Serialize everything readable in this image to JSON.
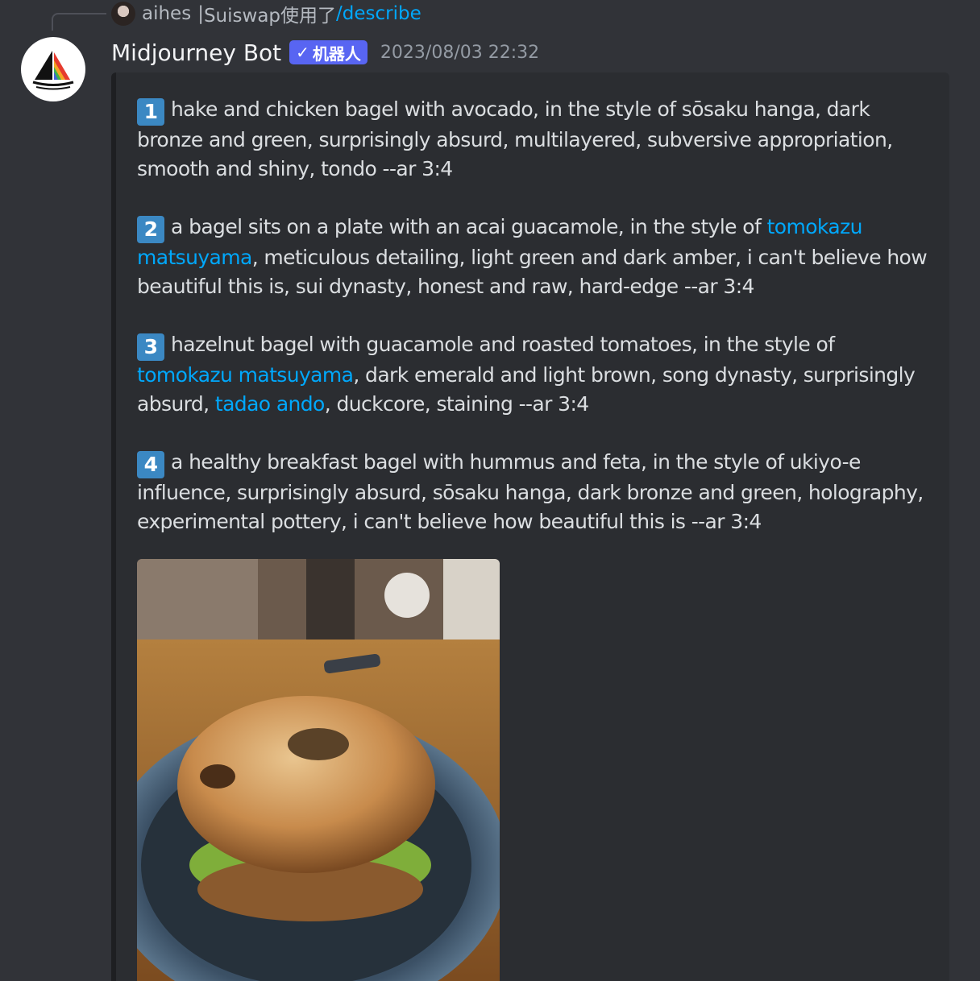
{
  "reply": {
    "username": "aihes",
    "separator": "|",
    "context": "Suiswap使用了",
    "command": "/describe"
  },
  "message": {
    "author": "Midjourney Bot",
    "badge": "机器人",
    "badge_check": "✓",
    "timestamp": "2023/08/03 22:32"
  },
  "prompts": [
    {
      "number": "1",
      "segments": [
        {
          "text": "hake and chicken bagel with avocado, in the style of sōsaku hanga, dark bronze and green, surprisingly absurd, multilayered, subversive appropriation, smooth and shiny, tondo --ar 3:4",
          "link": false
        }
      ]
    },
    {
      "number": "2",
      "segments": [
        {
          "text": "a bagel sits on a plate with an acai guacamole, in the style of ",
          "link": false
        },
        {
          "text": "tomokazu matsuyama",
          "link": true
        },
        {
          "text": ", meticulous detailing, light green and dark amber, i can't believe how beautiful this is, sui dynasty, honest and raw, hard-edge --ar 3:4",
          "link": false
        }
      ]
    },
    {
      "number": "3",
      "segments": [
        {
          "text": "hazelnut bagel with guacamole and roasted tomatoes, in the style of ",
          "link": false
        },
        {
          "text": "tomokazu matsuyama",
          "link": true
        },
        {
          "text": ", dark emerald and light brown, song dynasty, surprisingly absurd, ",
          "link": false
        },
        {
          "text": "tadao ando",
          "link": true
        },
        {
          "text": ", duckcore, staining --ar 3:4",
          "link": false
        }
      ]
    },
    {
      "number": "4",
      "segments": [
        {
          "text": "a healthy breakfast bagel with hummus and feta, in the style of ukiyo-e influence, surprisingly absurd, sōsaku hanga, dark bronze and green, holography, experimental pottery, i can't believe how beautiful this is --ar 3:4",
          "link": false
        }
      ]
    }
  ],
  "colors": {
    "background": "#313338",
    "embed_background": "#2b2d31",
    "link": "#00a8fc",
    "badge": "#5865f2",
    "number_badge": "#3b88c3"
  },
  "icons": {
    "bot_avatar": "midjourney-sailboat-icon",
    "badge_check": "checkmark-icon",
    "attachment": "bagel-photo"
  }
}
